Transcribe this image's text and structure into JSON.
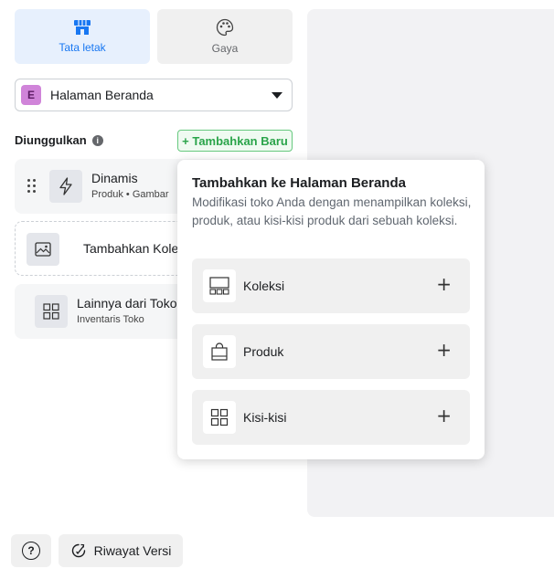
{
  "tabs": {
    "layout_label": "Tata letak",
    "style_label": "Gaya",
    "active_color": "#1877f2"
  },
  "page_select": {
    "badge": "E",
    "value": "Halaman Beranda"
  },
  "featured": {
    "label": "Diunggulkan",
    "add_new_label": "+ Tambahkan Baru"
  },
  "cards": {
    "dynamic": {
      "title": "Dinamis",
      "subtitle": "Produk • Gambar",
      "icon": "lightning-icon"
    },
    "add": {
      "title": "Tambahkan Kole",
      "icon": "image-icon"
    },
    "more": {
      "title": "Lainnya dari Toko",
      "subtitle": "Inventaris Toko",
      "icon": "grid-icon"
    }
  },
  "popover": {
    "title": "Tambahkan ke Halaman Beranda",
    "description": "Modifikasi toko Anda dengan menampilkan koleksi, produk, atau kisi-kisi produk dari sebuah koleksi.",
    "items": [
      {
        "label": "Koleksi",
        "icon": "collection-icon"
      },
      {
        "label": "Produk",
        "icon": "shopping-bag-icon"
      },
      {
        "label": "Kisi-kisi",
        "icon": "grid-icon"
      }
    ],
    "plus": "+"
  },
  "footer": {
    "help": "?",
    "history_label": "Riwayat Versi"
  }
}
